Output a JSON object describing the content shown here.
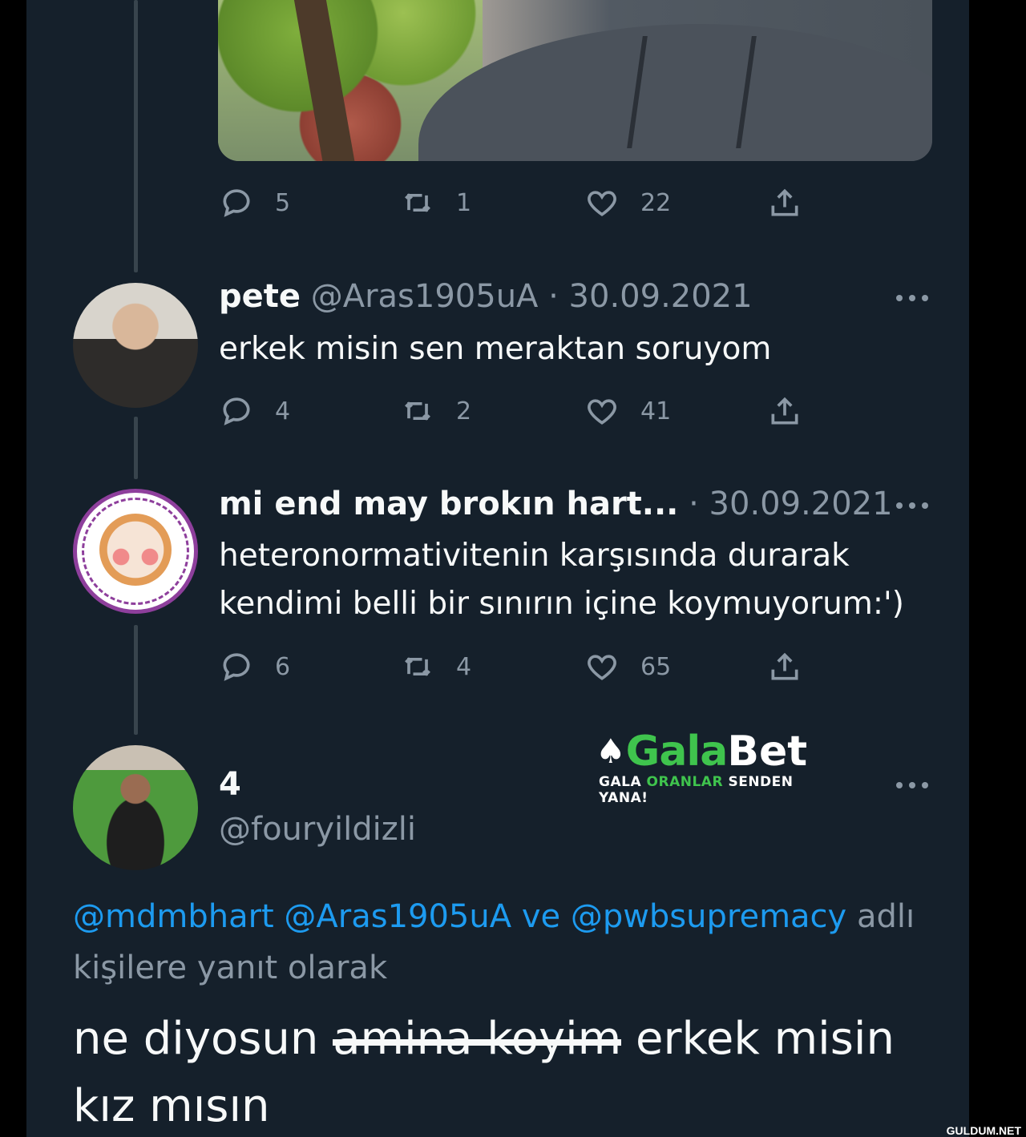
{
  "tweet0": {
    "actions": {
      "replies": "5",
      "retweets": "1",
      "likes": "22"
    }
  },
  "tweet1": {
    "name": "pete",
    "meta": "@Aras1905uA · 30.09.2021",
    "text": "erkek misin sen meraktan soruyom",
    "actions": {
      "replies": "4",
      "retweets": "2",
      "likes": "41"
    }
  },
  "tweet2": {
    "name": "mi end may brokın hart...",
    "meta": "· 30.09.2021",
    "text_line1": "heteronormativitenin karşısında durarak",
    "text_line2": "kendimi belli bir sınırın içine koymuyorum:')",
    "avatar_badge": "İSTANBUL SÖZLEŞMESİ YAŞATIR TCK-103 6284'Ü UYGULA",
    "actions": {
      "replies": "6",
      "retweets": "4",
      "likes": "65"
    }
  },
  "tweet3": {
    "name": "4",
    "handle": "@fouryildizli",
    "replying": {
      "mention1": "@mdmbhart",
      "mention2": "@Aras1905uA",
      "connector": "ve",
      "mention3": "@pwbsupremacy",
      "suffix": "adlı",
      "line2": "kişilere yanıt olarak"
    },
    "text_before": "ne diyosun ",
    "text_struck": "amina koyim",
    "text_after": " erkek misin kız mısın"
  },
  "promo": {
    "brand_part1": "Gala",
    "brand_part2": "Bet",
    "tagline_1": "GALA ",
    "tagline_2": "ORANLAR",
    "tagline_3": " SENDEN YANA!",
    "accent": "#3fc44d"
  },
  "watermark": "GULDUM.NET",
  "colors": {
    "background": "#15202b",
    "text": "#f7f9f9",
    "muted": "#8b98a5",
    "link": "#1d9bf0"
  },
  "icons": [
    "reply-icon",
    "retweet-icon",
    "like-icon",
    "share-icon",
    "more-icon",
    "spade-icon"
  ]
}
